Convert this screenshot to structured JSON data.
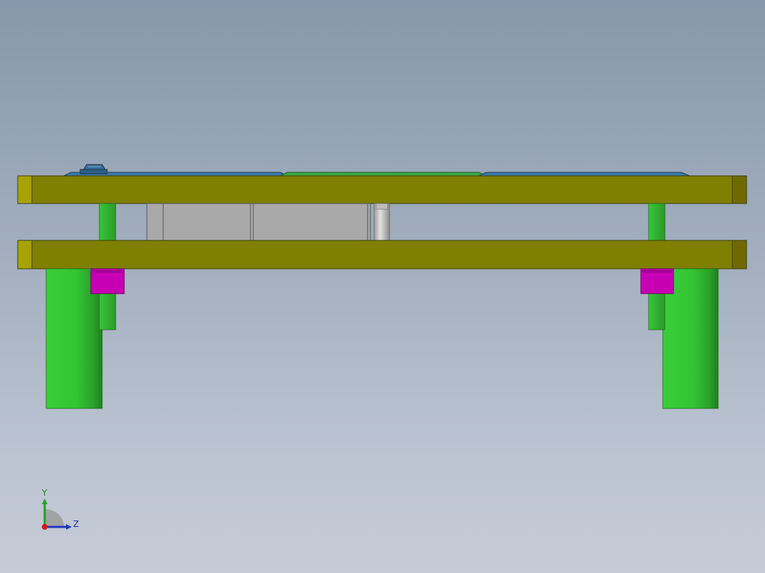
{
  "view": {
    "background_top": "#8698ab",
    "background_bottom": "#c6cbd6"
  },
  "colors": {
    "plate": "#7f7f00",
    "plate_end": "#a8a300",
    "plate_edge": "#3f3f00",
    "pillar_green": "#2fbf2f",
    "pillar_green_dark": "#1f8f1f",
    "bushing": "#c800b4",
    "block_gray": "#a8a8a8",
    "pin_silver": "#c8c8c8",
    "top_blue": "#3a7aa8",
    "top_green": "#3aa845"
  },
  "triad": {
    "y_label": "Y",
    "z_label": "Z",
    "icon": "view-orientation-triad-icon"
  }
}
